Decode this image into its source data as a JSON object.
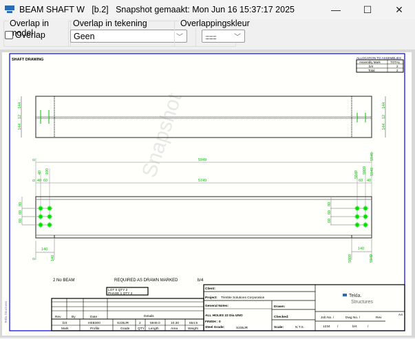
{
  "window": {
    "title": "BEAM SHAFT W   [b.2]   Snapshot gemaakt: Mon Jun 16 15:37:17 2025",
    "minimize": "—",
    "maximize": "☐",
    "close": "✕"
  },
  "toolbar": {
    "overlap_model": {
      "label": "Overlap in model",
      "checkbox_label": "Overlap",
      "checked": false
    },
    "overlap_drawing": {
      "label": "Overlap in tekening",
      "value": "Geen"
    },
    "overlap_color": {
      "label": "Overlappingskleur",
      "value": ":::::::::::::"
    }
  },
  "drawing": {
    "title": "SHAFT DRAWING",
    "watermark": "Snapshot",
    "side_text": "Tekla Structures",
    "allocation": {
      "title": "ALLOCATION TO ASSEMBLIES",
      "headers": [
        "Assembly Mark",
        "TOTAL"
      ],
      "rows": [
        [
          "b/4",
          "2"
        ],
        [
          "Total",
          "2"
        ]
      ]
    },
    "dims_top": {
      "left": [
        "144",
        "12",
        "144"
      ],
      "right": [
        "144",
        "12",
        "144"
      ]
    },
    "dims_front": {
      "overall": "5949",
      "inner": "5749",
      "zero": "0",
      "d40": "40",
      "d60": "60",
      "d100": "100",
      "r5849": "5849",
      "r5909": "5909",
      "r5949": "5949",
      "r60": "60",
      "r40": "40",
      "v80": "80",
      "v60a": "60",
      "v60b": "60",
      "b140": "140",
      "b140r": "140",
      "b5809": "5809",
      "b5949": "5949",
      "b0": "0",
      "b140v": "140"
    },
    "required": {
      "qty": "2  No  BEAM",
      "text": "REQUIRED AS DRAWN MARKED",
      "mark": "b/4"
    },
    "lot": {
      "line1": "LOT     0     QTY  2",
      "line2": "PHASE  1     QTY  2"
    },
    "rev_table": {
      "headers": [
        "Rev",
        "By",
        "Date",
        "Details"
      ]
    },
    "parts_table": {
      "values": [
        "b/4",
        "HEB300",
        "S235JR",
        "2",
        "5949.0",
        "10.30",
        "654.9"
      ],
      "headers": [
        "Mark",
        "Profile",
        "Grade",
        "QTY",
        "Length",
        "Area",
        "Weight"
      ]
    },
    "title_block": {
      "client": "Client:",
      "project_label": "Project:",
      "project": "Trimble Solutions Corporation",
      "notes": "General Notes:",
      "holes": "ALL HOLES    22    Dia UNO",
      "finish": "FINISH :  0",
      "steel": "Steel Grade:",
      "steel_val": "S235JR",
      "drawn": "Drawn:",
      "checked": "Checked:",
      "scale": "Scale:",
      "scale_val": "N.T.S.",
      "job_h": "Job No.   /",
      "dwg_h": "Dwg No.   /",
      "rev_h": "Rev",
      "size": "A4",
      "job": "1234",
      "job_sep": "/",
      "dwg": "b/4",
      "dwg_sep": "/",
      "logo1": "Tekla.",
      "logo2": "Structures"
    }
  },
  "colors": {
    "dim": "#00c000",
    "frame": "#0000e0",
    "hole": "#00e000"
  }
}
